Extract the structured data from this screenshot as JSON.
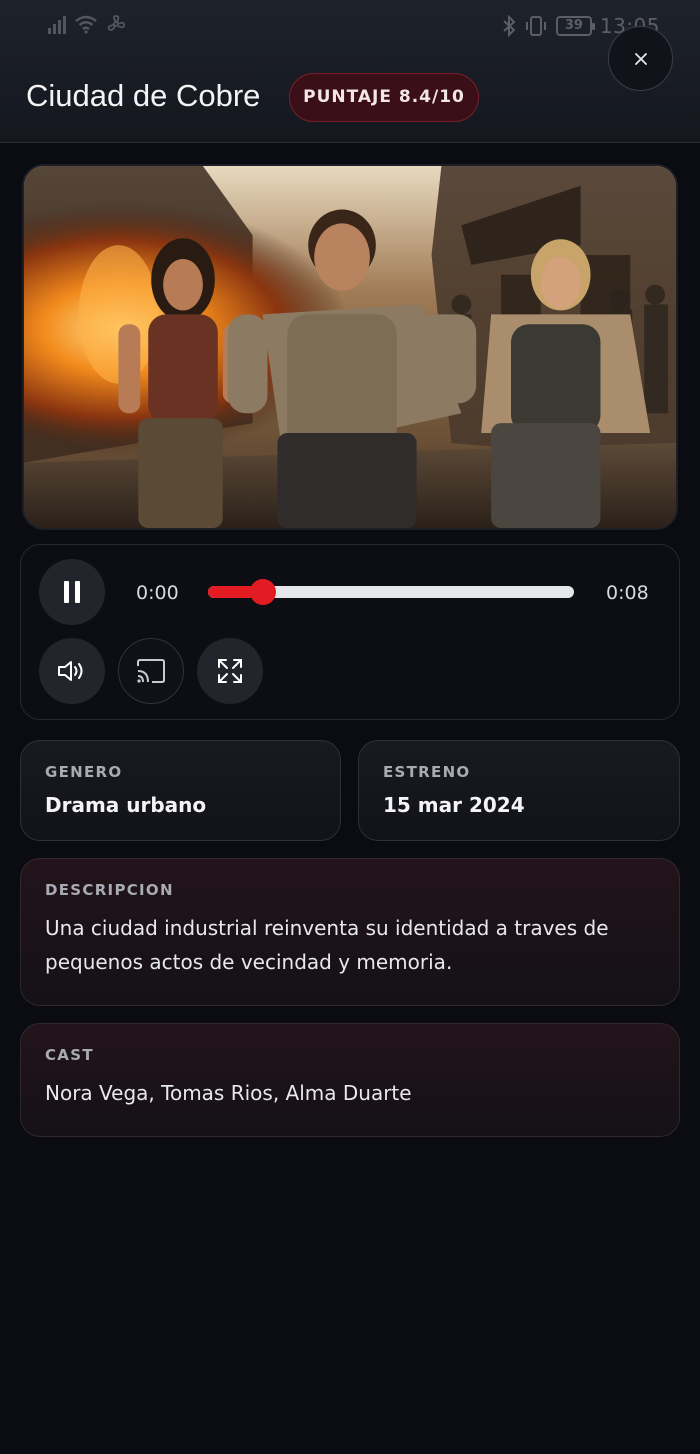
{
  "status_bar": {
    "time": "13:05",
    "battery": "39"
  },
  "header": {
    "title": "Ciudad de Cobre",
    "score_badge": "PUNTAJE 8.4/10",
    "close_label": "×"
  },
  "video": {
    "image_description": "Three people running through a burning market street"
  },
  "player": {
    "current_time": "0:00",
    "duration": "0:08",
    "progress_fraction": 0.15
  },
  "info": {
    "genre": {
      "label": "GENERO",
      "value": "Drama urbano"
    },
    "release": {
      "label": "ESTRENO",
      "value": "15 mar 2024"
    },
    "description": {
      "label": "DESCRIPCION",
      "text": "Una ciudad industrial reinventa su identidad a traves de pequenos actos de vecindad y memoria."
    },
    "cast": {
      "label": "CAST",
      "text": "Nora Vega, Tomas Rios, Alma Duarte"
    }
  },
  "colors": {
    "accent": "#e31b23",
    "badge_bg": "#3a0f17",
    "background": "#0b0c11"
  }
}
